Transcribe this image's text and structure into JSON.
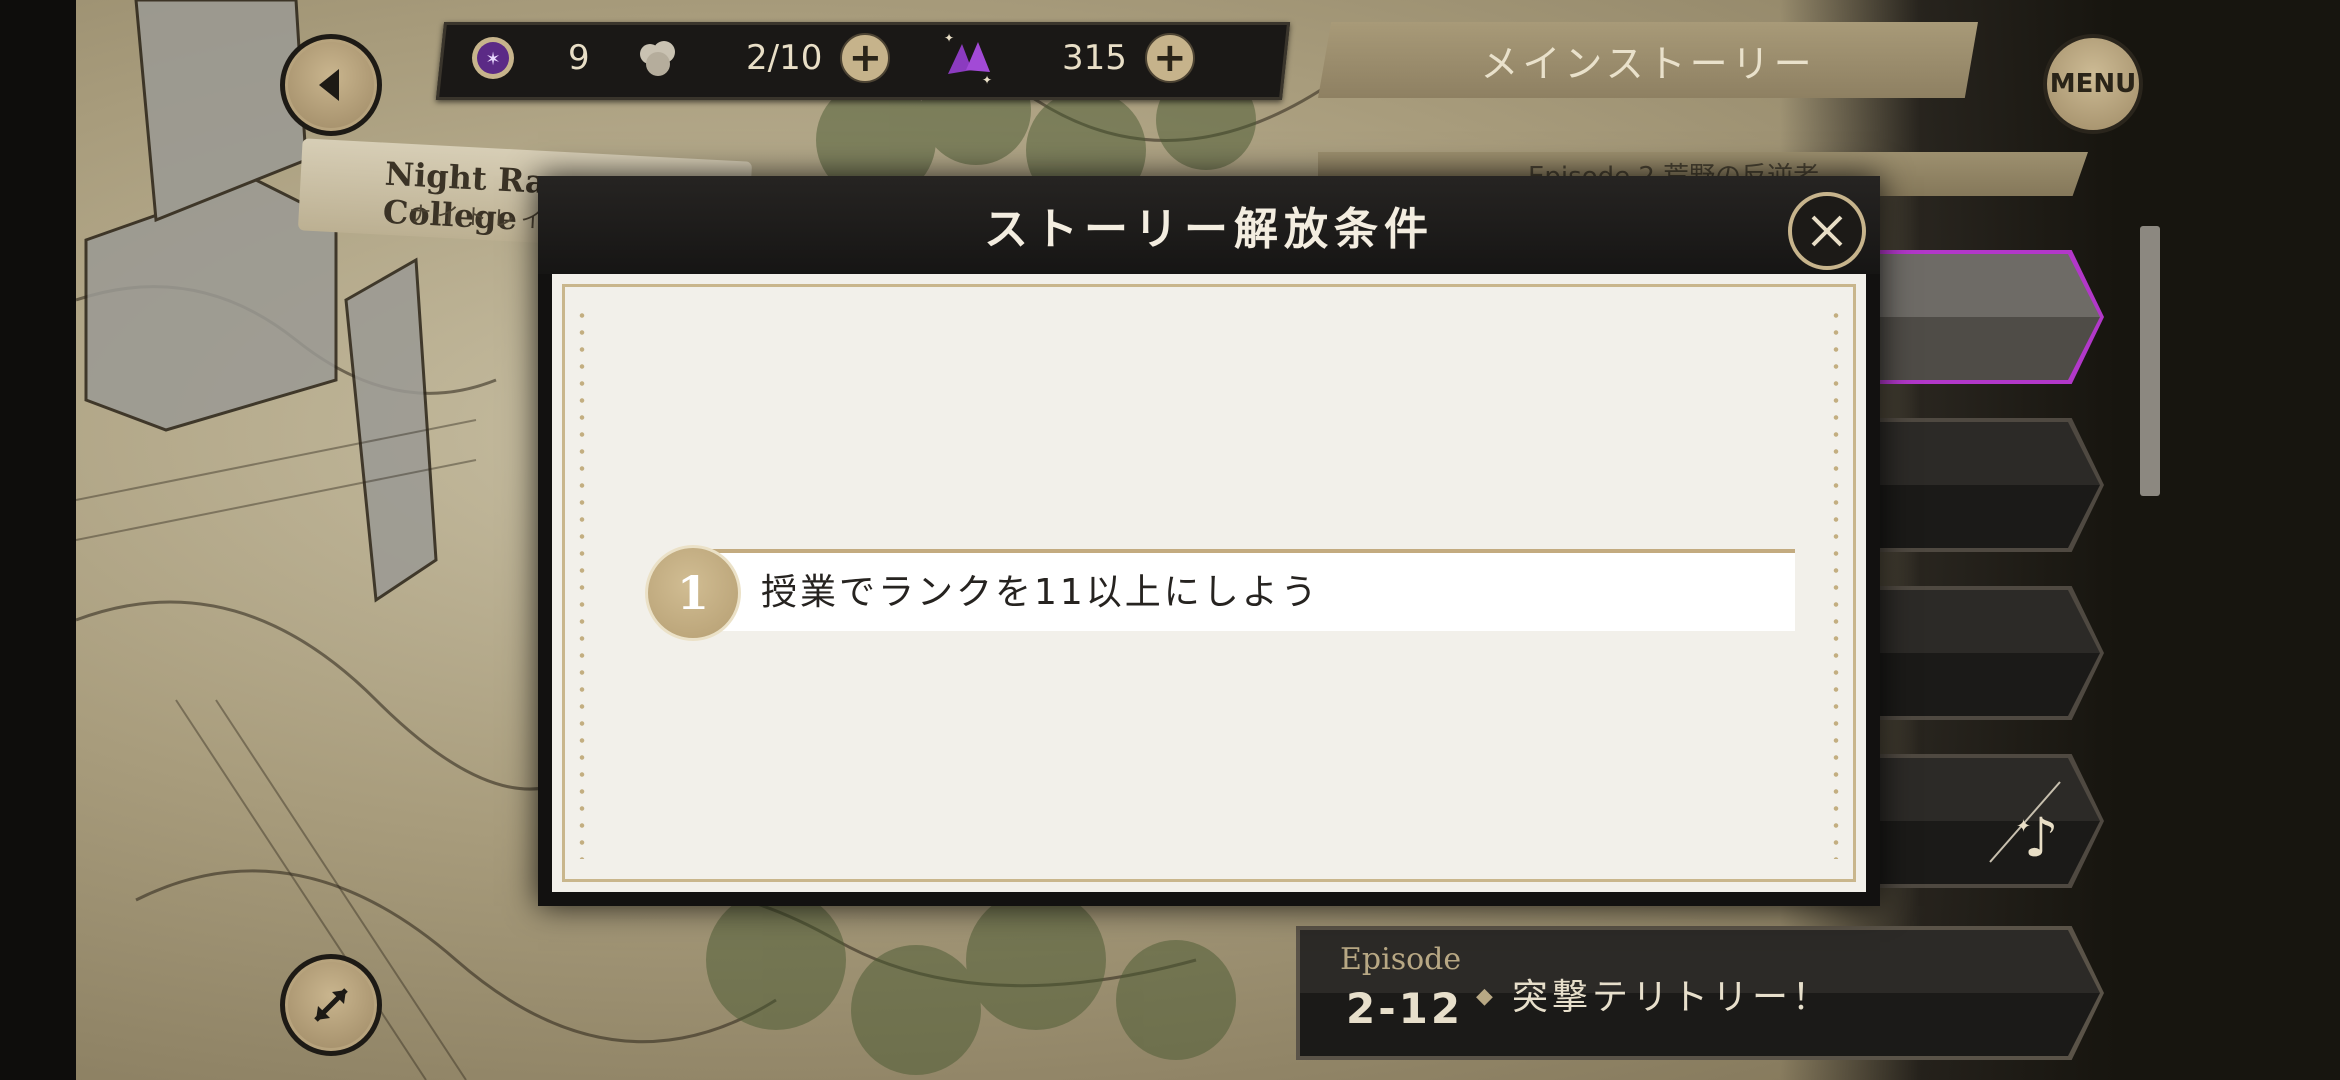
{
  "resources": {
    "gem_count": "9",
    "stamina": "2/10",
    "currency": "315"
  },
  "header": {
    "title": "メインストーリー",
    "episode_banner": "Episode 2  荒野の反逆者",
    "menu_label": "MENU"
  },
  "map_label": {
    "en": "Night Raven College",
    "jp": "ナイトレイブン"
  },
  "modal": {
    "title": "ストーリー解放条件",
    "conditions": [
      {
        "number": "1",
        "text": "授業でランクを11以上にしよう"
      }
    ]
  },
  "bottom_episode": {
    "label": "Episode",
    "number": "2-12",
    "title": "突撃テリトリー！"
  },
  "colors": {
    "accent_gold": "#c7b48c",
    "highlight_purple": "#b238c9",
    "modal_background": "#f2f0ea"
  },
  "icons": {
    "back": "arrow-left-icon",
    "expand": "expand-arrows-icon",
    "close": "close-icon",
    "gem": "purple-gem-icon",
    "stamina": "stamina-blob-icon",
    "currency": "magic-crystal-icon",
    "music": "music-note-icon"
  }
}
